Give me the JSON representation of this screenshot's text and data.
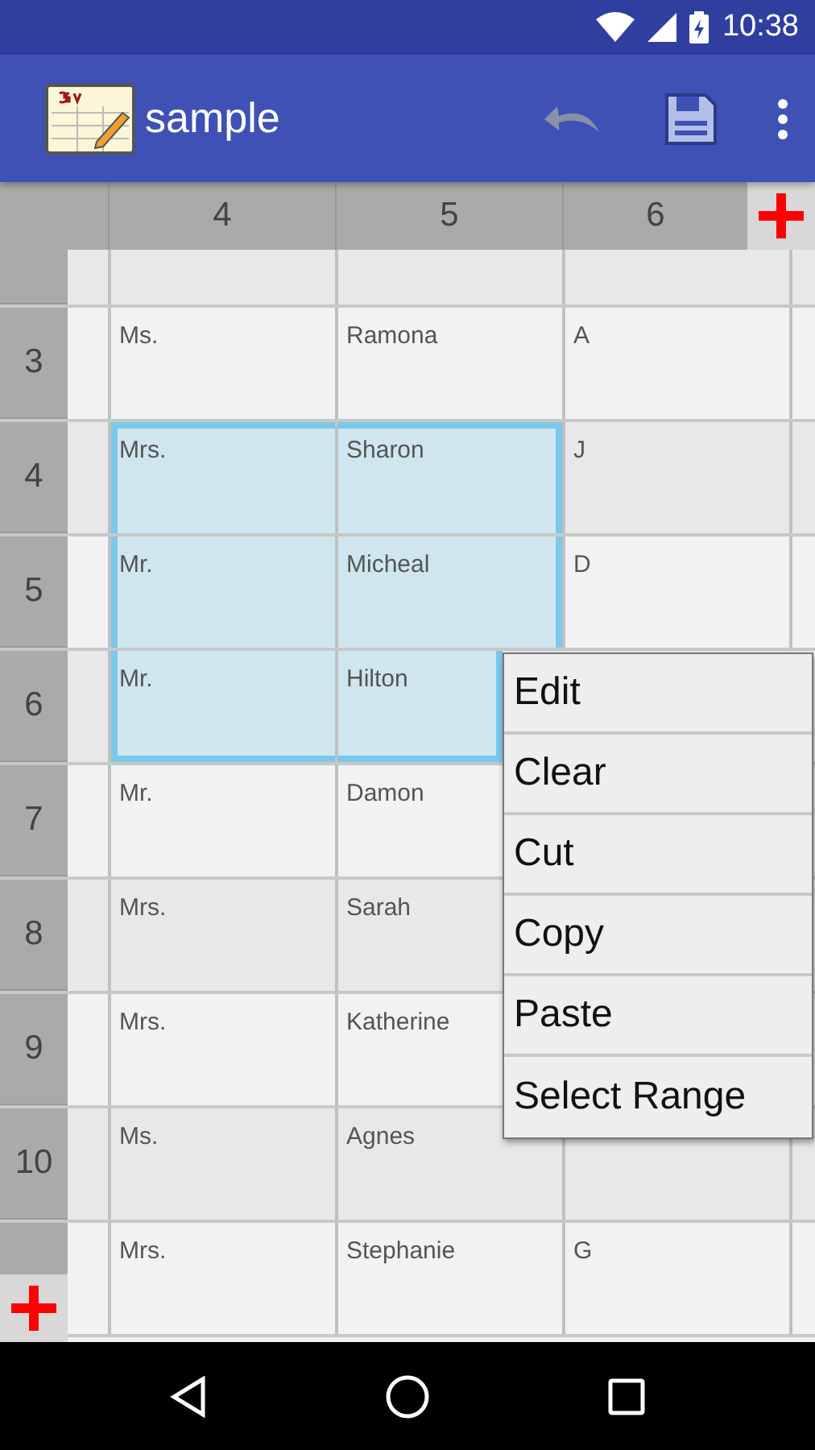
{
  "status_bar": {
    "time": "10:38"
  },
  "app_bar": {
    "title": "sample",
    "undo_disabled": true
  },
  "columns": [
    "4",
    "5",
    "6"
  ],
  "rows": [
    {
      "cells": [
        {
          "selected": false
        },
        {
          "selected": false
        },
        {
          "selected": false
        },
        {
          "selected": false
        }
      ]
    },
    {
      "label": "3",
      "cells": [
        {
          "text": "Ms.",
          "selected": false
        },
        {
          "text": "Ramona",
          "selected": false
        },
        {
          "text": "A",
          "selected": false
        },
        {
          "selected": false
        }
      ]
    },
    {
      "label": "4",
      "cells": [
        {
          "text": "Mrs.",
          "selected": true
        },
        {
          "text": "Sharon",
          "selected": true
        },
        {
          "text": "J",
          "selected": false
        },
        {
          "selected": false
        }
      ]
    },
    {
      "label": "5",
      "cells": [
        {
          "text": "Mr.",
          "selected": true
        },
        {
          "text": "Micheal",
          "selected": true
        },
        {
          "text": "D",
          "selected": false
        },
        {
          "selected": false
        }
      ]
    },
    {
      "label": "6",
      "cells": [
        {
          "text": "Mr.",
          "selected": true
        },
        {
          "text": "Hilton",
          "selected": true
        },
        {},
        {}
      ]
    },
    {
      "label": "7",
      "cells": [
        {
          "text": "Mr.",
          "selected": false
        },
        {
          "text": "Damon",
          "selected": false
        },
        {},
        {}
      ]
    },
    {
      "label": "8",
      "cells": [
        {
          "text": "Mrs.",
          "selected": false
        },
        {
          "text": "Sarah",
          "selected": false
        },
        {},
        {}
      ]
    },
    {
      "label": "9",
      "cells": [
        {
          "text": "Mrs.",
          "selected": false
        },
        {
          "text": "Katherine",
          "selected": false
        },
        {},
        {}
      ]
    },
    {
      "label": "10",
      "cells": [
        {
          "text": "Ms.",
          "selected": false
        },
        {
          "text": "Agnes",
          "selected": false
        },
        {
          "selected": false
        },
        {
          "selected": false
        }
      ]
    },
    {
      "cells": [
        {
          "text": "Mrs.",
          "selected": false
        },
        {
          "text": "Stephanie",
          "selected": false
        },
        {
          "text": "G",
          "selected": false
        },
        {
          "selected": false
        }
      ]
    }
  ],
  "context_menu": [
    "Edit",
    "Clear",
    "Cut",
    "Copy",
    "Paste",
    "Select Range"
  ]
}
